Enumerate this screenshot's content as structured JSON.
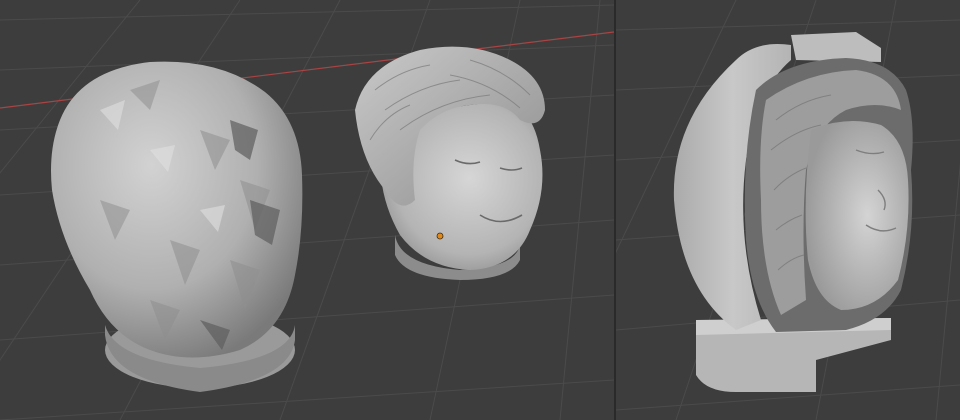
{
  "app": {
    "theme": {
      "background": "#3d3d3d",
      "grid_line": "#4a4a4a",
      "grid_line_major": "#505050",
      "x_axis": "#b04040",
      "mesh_light": "#c4c4c4",
      "mesh_mid": "#a8a8a8",
      "mesh_dark": "#6e6e6e",
      "origin_marker": "#e08a1e",
      "split_border": "#2a2a2a"
    }
  },
  "viewports": {
    "left": {
      "objects": [
        "low-poly-head-mesh",
        "detailed-head-scan-mesh"
      ],
      "origin_marker_icon": "origin-dot-icon"
    },
    "right": {
      "objects": [
        "sectioned-head-mold-mesh"
      ]
    }
  }
}
